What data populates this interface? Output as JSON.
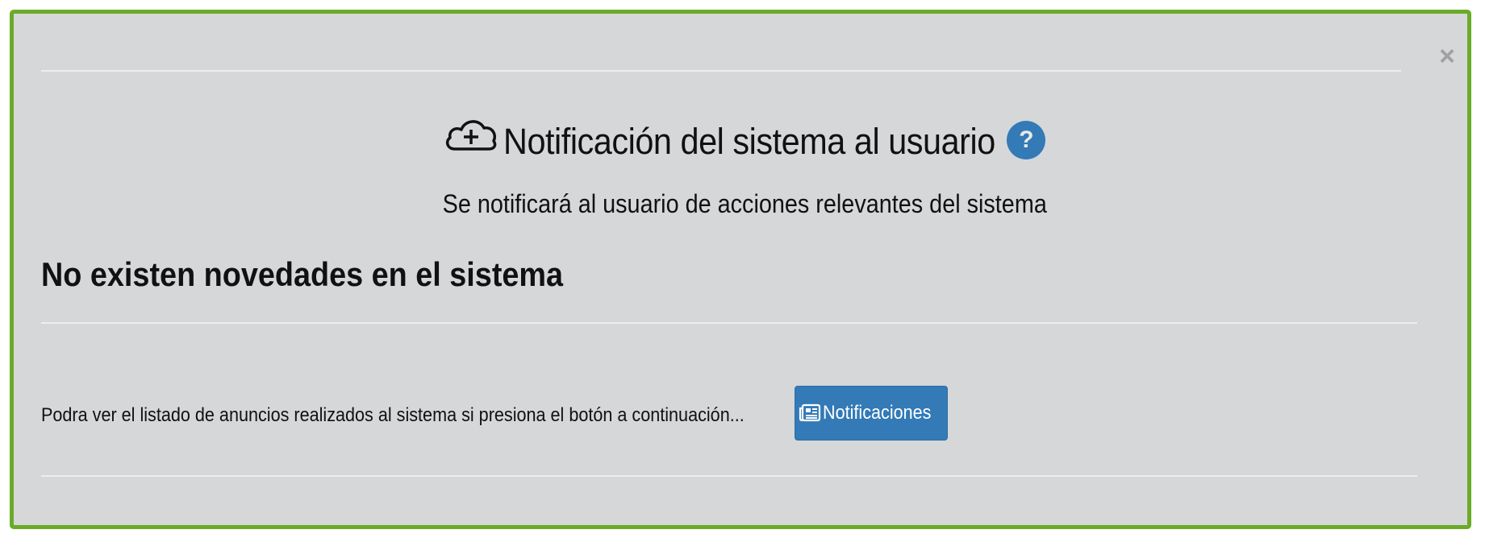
{
  "modal": {
    "close_label": "×",
    "title": "Notificación del sistema al usuario",
    "help_label": "?",
    "subtitle": "Se notificará al usuario de acciones relevantes del sistema",
    "heading": "No existen novedades en el sistema",
    "info_text": "Podra ver el listado de anuncios realizados al sistema si presiona el botón a continuación...",
    "button_label": "Notificaciones"
  },
  "icons": {
    "header": "cloud-upload-icon",
    "help": "question-circle-icon",
    "button": "newspaper-icon",
    "close": "close-icon"
  },
  "colors": {
    "border": "#6aab27",
    "background": "#d6d7d9",
    "primary": "#337ab7"
  }
}
